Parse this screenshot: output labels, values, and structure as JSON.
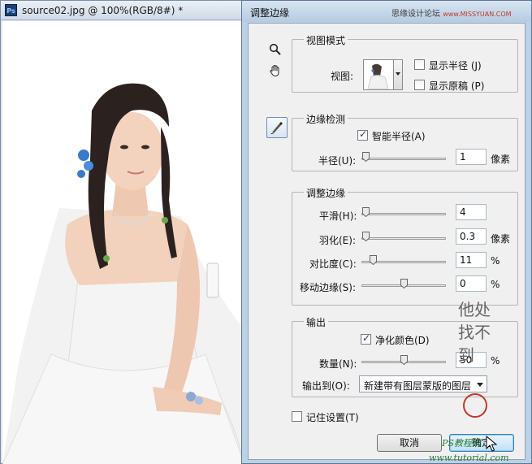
{
  "document": {
    "app_badge": "Ps",
    "title": "source02.jpg @ 100%(RGB/8#) *"
  },
  "dialog": {
    "title": "调整边缘",
    "watermark": "思缘设计论坛",
    "watermark_url": "www.MISSYUAN.COM",
    "view_mode": {
      "legend": "视图模式",
      "view_label": "视图:",
      "show_radius_label": "显示半径 (J)",
      "show_radius_checked": false,
      "show_original_label": "显示原稿 (P)",
      "show_original_checked": false
    },
    "edge_detection": {
      "legend": "边缘检测",
      "smart_radius_label": "智能半径(A)",
      "smart_radius_checked": true,
      "radius_label": "半径(U):",
      "radius_value": "1",
      "radius_unit": "像素"
    },
    "adjust_edge": {
      "legend": "调整边缘",
      "smooth_label": "平滑(H):",
      "smooth_value": "4",
      "feather_label": "羽化(E):",
      "feather_value": "0.3",
      "feather_unit": "像素",
      "contrast_label": "对比度(C):",
      "contrast_value": "11",
      "contrast_unit": "%",
      "shift_label": "移动边缘(S):",
      "shift_value": "0",
      "shift_unit": "%"
    },
    "output": {
      "legend": "输出",
      "decontaminate_label": "净化颜色(D)",
      "decontaminate_checked": true,
      "amount_label": "数量(N):",
      "amount_value": "50",
      "amount_unit": "%",
      "output_to_label": "输出到(O):",
      "output_to_value": "新建带有图层蒙版的图层"
    },
    "remember_label": "记住设置(T)",
    "remember_checked": false,
    "cancel_label": "取消",
    "ok_label": "确定"
  },
  "overlay_watermark": {
    "vertical_text": "他处找不到",
    "site_name": "PS教程网",
    "site_url": "www.tutorial.com"
  },
  "colors": {
    "dialog_bg": "#f0f0f0",
    "titlebar": "#c6d7ea",
    "default_button": "#bfe0f7"
  }
}
